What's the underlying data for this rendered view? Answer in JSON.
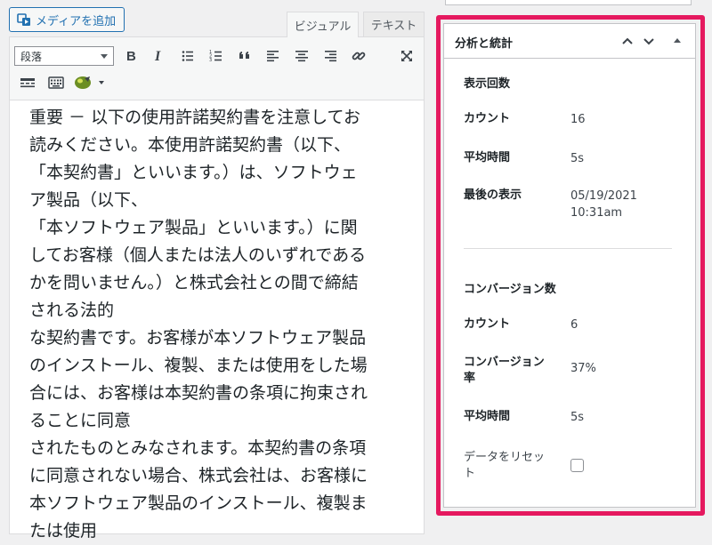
{
  "editor": {
    "media_button": "メディアを追加",
    "tabs": {
      "visual": "ビジュアル",
      "text": "テキスト"
    },
    "format_select": "段落",
    "content_lines": [
      "重要 － 以下の使用許諾契約書を注意してお",
      "読みください。本使用許諾契約書（以下、",
      "「本契約書」といいます。）は、ソフトウェ",
      "ア製品（以下、",
      "「本ソフトウェア製品」といいます。）に関",
      "してお客様（個人または法人のいずれである",
      "かを問いません。）と株式会社との間で締結",
      "される法的",
      "な契約書です。お客様が本ソフトウェア製品",
      "のインストール、複製、または使用をした場",
      "合には、お客様は本契約書の条項に拘束され",
      "ることに同意",
      "されたものとみなされます。本契約書の条項",
      "に同意されない場合、株式会社は、お客様に",
      "本ソフトウェア製品のインストール、複製ま",
      "たは使用"
    ]
  },
  "panel": {
    "title": "分析と統計",
    "views": {
      "heading": "表示回数",
      "count_label": "カウント",
      "count_value": "16",
      "avg_label": "平均時間",
      "avg_value": "5s",
      "last_label": "最後の表示",
      "last_date": "05/19/2021",
      "last_time": "10:31am"
    },
    "conversions": {
      "heading": "コンバージョン数",
      "count_label": "カウント",
      "count_value": "6",
      "rate_label_1": "コンバージョン",
      "rate_label_2": "率",
      "rate_value": "37%",
      "avg_label": "平均時間",
      "avg_value": "5s"
    },
    "reset_label_1": "データをリセッ",
    "reset_label_2": "ト"
  },
  "colors": {
    "highlight": "#e5195f",
    "accent": "#2271b1"
  }
}
